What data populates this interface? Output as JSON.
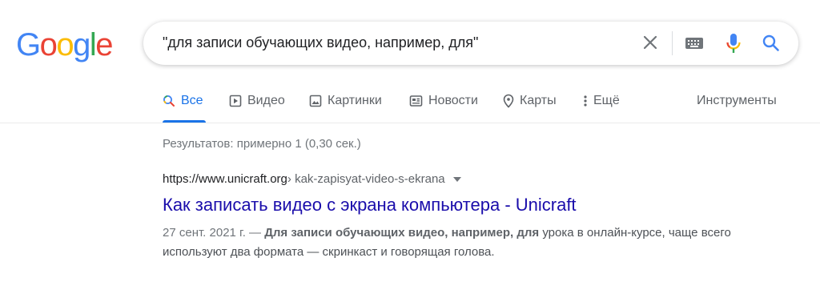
{
  "logo": {
    "letters": [
      "G",
      "o",
      "o",
      "g",
      "l",
      "e"
    ],
    "colors": [
      "#4285f4",
      "#ea4335",
      "#fbbc05",
      "#4285f4",
      "#34a853",
      "#ea4335"
    ]
  },
  "search": {
    "query": "\"для записи обучающих видео, например, для\""
  },
  "tabs": [
    {
      "label": "Все",
      "icon": "search-icon",
      "active": true
    },
    {
      "label": "Видео",
      "icon": "video-icon"
    },
    {
      "label": "Картинки",
      "icon": "image-icon"
    },
    {
      "label": "Новости",
      "icon": "news-icon"
    },
    {
      "label": "Карты",
      "icon": "map-pin-icon"
    },
    {
      "label": "Ещё",
      "icon": "more-icon"
    }
  ],
  "tools_label": "Инструменты",
  "stats": "Результатов: примерно 1 (0,30 сек.)",
  "results": [
    {
      "domain": "https://www.unicraft.org",
      "path": " › kak-zapisyat-video-s-ekrana",
      "title": "Как записать видео с экрана компьютера - Unicraft",
      "date": "27 сент. 2021 г. — ",
      "highlight": "Для записи обучающих видео, например, для",
      "snippet_rest": " урока в онлайн-курсе, чаще всего используют два формата — скринкаст и говорящая голова."
    }
  ],
  "accent_color": "#1a73e8",
  "link_color": "#1a0dab"
}
